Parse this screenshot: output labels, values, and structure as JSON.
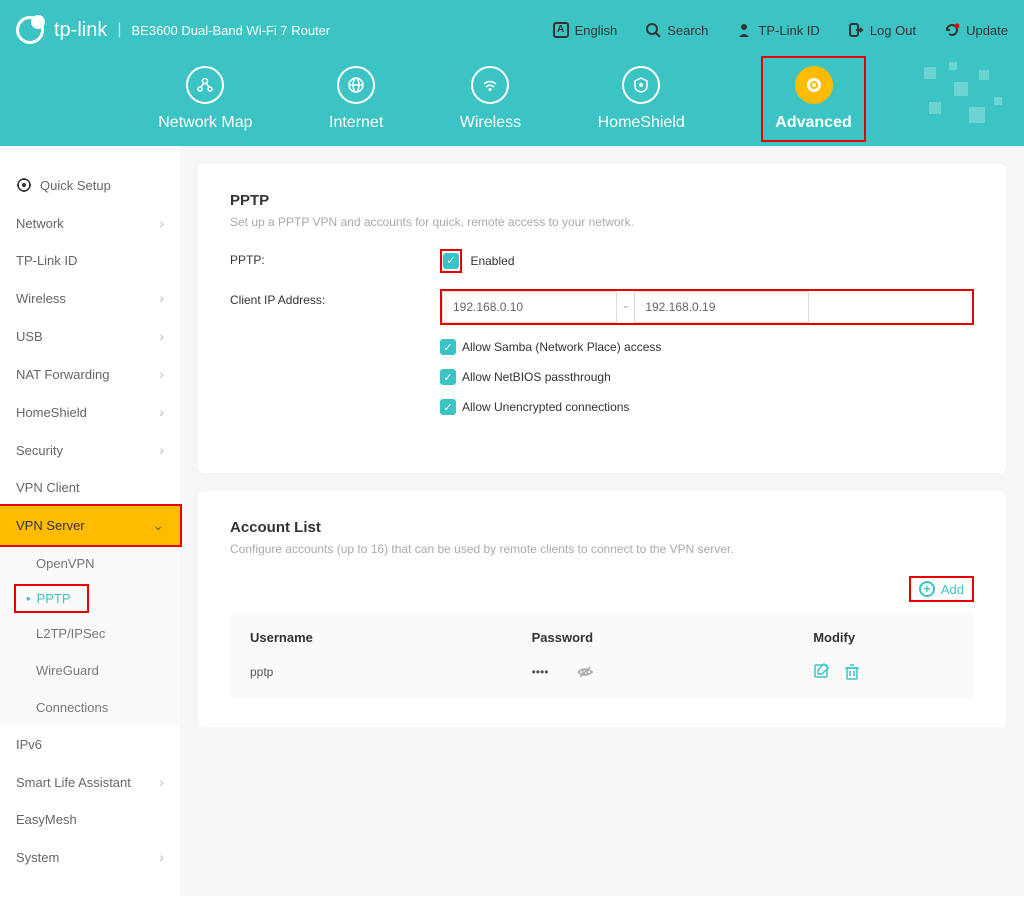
{
  "header": {
    "brand": "tp-link",
    "device": "BE3600 Dual-Band Wi-Fi 7 Router",
    "links": {
      "language": "English",
      "search": "Search",
      "tplink_id": "TP-Link ID",
      "logout": "Log Out",
      "update": "Update"
    },
    "tabs": {
      "network_map": "Network Map",
      "internet": "Internet",
      "wireless": "Wireless",
      "homeshield": "HomeShield",
      "advanced": "Advanced"
    }
  },
  "sidebar": {
    "quick_setup": "Quick Setup",
    "network": "Network",
    "tplink_id": "TP-Link ID",
    "wireless": "Wireless",
    "usb": "USB",
    "nat_forwarding": "NAT Forwarding",
    "homeshield": "HomeShield",
    "security": "Security",
    "vpn_client": "VPN Client",
    "vpn_server": "VPN Server",
    "vpn_sub": {
      "openvpn": "OpenVPN",
      "pptp": "PPTP",
      "l2tp": "L2TP/IPSec",
      "wireguard": "WireGuard",
      "connections": "Connections"
    },
    "ipv6": "IPv6",
    "smart_life": "Smart Life Assistant",
    "easymesh": "EasyMesh",
    "system": "System"
  },
  "pptp": {
    "title": "PPTP",
    "desc": "Set up a PPTP VPN and accounts for quick, remote access to your network.",
    "label_pptp": "PPTP:",
    "enabled": "Enabled",
    "label_ip": "Client IP Address:",
    "ip_start": "192.168.0.10",
    "ip_end": "192.168.0.19",
    "allow_samba": "Allow Samba (Network Place) access",
    "allow_netbios": "Allow NetBIOS passthrough",
    "allow_unencrypted": "Allow Unencrypted connections"
  },
  "accounts": {
    "title": "Account List",
    "desc": "Configure accounts (up to 16) that can be used by remote clients to connect to the VPN server.",
    "add": "Add",
    "col_user": "Username",
    "col_pass": "Password",
    "col_modify": "Modify",
    "rows": [
      {
        "user": "pptp",
        "pass": "••••"
      }
    ]
  }
}
